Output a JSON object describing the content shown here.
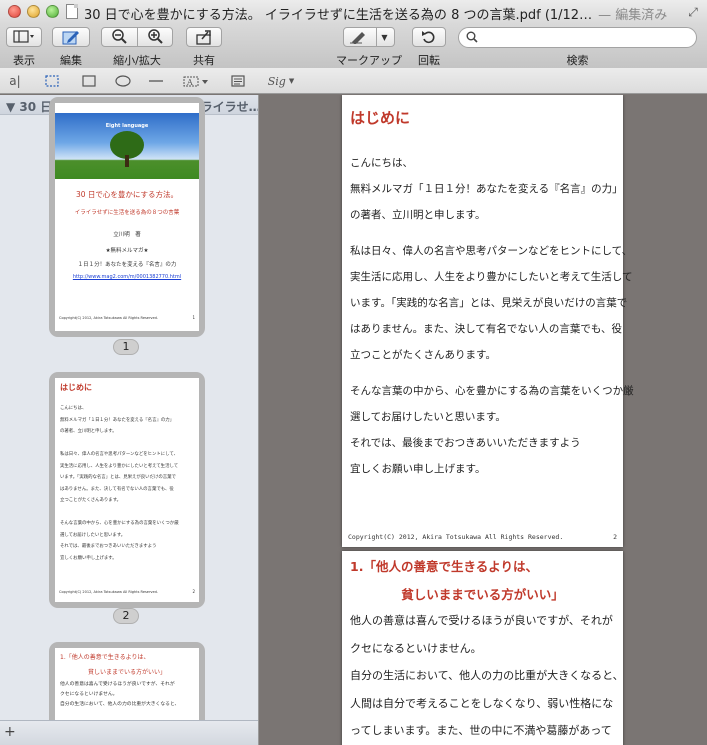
{
  "window": {
    "title": "30 日で心を豊かにする方法。 イライラせずに生活を送る為の 8 つの言葉.pdf (1/12…",
    "status": "— 編集済み"
  },
  "toolbar": {
    "view_label": "表示",
    "edit_label": "編集",
    "zoom_label": "縮小/拡大",
    "share_label": "共有",
    "markup_label": "マークアップ",
    "rotate_label": "回転",
    "search_label": "検索",
    "search_placeholder": ""
  },
  "annotation_tools": {
    "text_tool": "a|",
    "signature": "Sig"
  },
  "sidebar": {
    "header": "▼ 30 日で心を豊かにする方法。 イライラせ…",
    "thumbnails": [
      {
        "page_number": "1",
        "image_text": "Eight language",
        "title": "30 日で心を豊かにする方法。",
        "subtitle": "イライラせずに生活を送る為の８つの言葉",
        "author": "立川明　著",
        "mag_label": "★無料メルマガ★",
        "mag_name": "１日１分！あなたを変える『名言』の力",
        "url": "http://www.mag2.com/m/0001382770.html",
        "copyright": "Copyright(C) 2012, Akira Totsukawa All Rights Reserved.",
        "footer_num": "1"
      },
      {
        "page_number": "2",
        "heading": "はじめに",
        "lines": [
          "こんにちは、",
          "無料メルマガ「１日１分！あなたを変える『名言』の力」",
          "の著者、立川明と申します。",
          "",
          "私は日々、偉人の名言や思考パターンなどをヒントにして、",
          "実生活に応用し、人生をより豊かにしたいと考えて生活して",
          "います。「実践的な名言」とは、見栄えが良いだけの言葉で",
          "はありません。また、決して有名でない人の言葉でも、役",
          "立つことがたくさんあります。",
          "",
          "そんな言葉の中から、心を豊かにする為の言葉をいくつか厳",
          "選してお届けしたいと思います。",
          "それでは、最後までおつきあいいただきますよう",
          "宜しくお願い申し上げます。"
        ],
        "copyright": "Copyright(C) 2012, Akira Totsukawa All Rights Reserved.",
        "footer_num": "2"
      },
      {
        "heading_line1": "1.「他人の善意で生きるよりは、",
        "heading_line2": "貧しいままでいる方がいい」",
        "lines": [
          "他人の善意は喜んで受けるほうが良いですが、それが",
          "クセになるといけません。",
          "自分の生活において、他人の力の比重が大きくなると、"
        ]
      }
    ]
  },
  "main": {
    "page2": {
      "heading": "はじめに",
      "paragraphs": [
        "こんにちは、",
        "無料メルマガ「１日１分！あなたを変える『名言』の力」",
        "の著者、立川明と申します。",
        "私は日々、偉人の名言や思考パターンなどをヒントにして、",
        "実生活に応用し、人生をより豊かにしたいと考えて生活して",
        "います。「実践的な名言」とは、見栄えが良いだけの言葉で",
        "はありません。また、決して有名でない人の言葉でも、役",
        "立つことがたくさんあります。",
        "そんな言葉の中から、心を豊かにする為の言葉をいくつか厳",
        "選してお届けしたいと思います。",
        "それでは、最後までおつきあいいただきますよう",
        "宜しくお願い申し上げます。"
      ],
      "copyright": "Copyright(C) 2012, Akira Totsukawa All Rights Reserved.",
      "page_num": "2"
    },
    "page3": {
      "heading_line1": "1.「他人の善意で生きるよりは、",
      "heading_line2": "貧しいままでいる方がいい」",
      "lines": [
        "他人の善意は喜んで受けるほうが良いですが、それが",
        "クセになるといけません。",
        "自分の生活において、他人の力の比重が大きくなると、",
        "人間は自分で考えることをしなくなり、弱い性格にな",
        "ってしまいます。また、世の中に不満や葛藤があって"
      ]
    }
  },
  "colors": {
    "accent_red": "#c0392b",
    "sidebar_bg": "#e3e7ed",
    "canvas_bg": "#7a7573"
  }
}
